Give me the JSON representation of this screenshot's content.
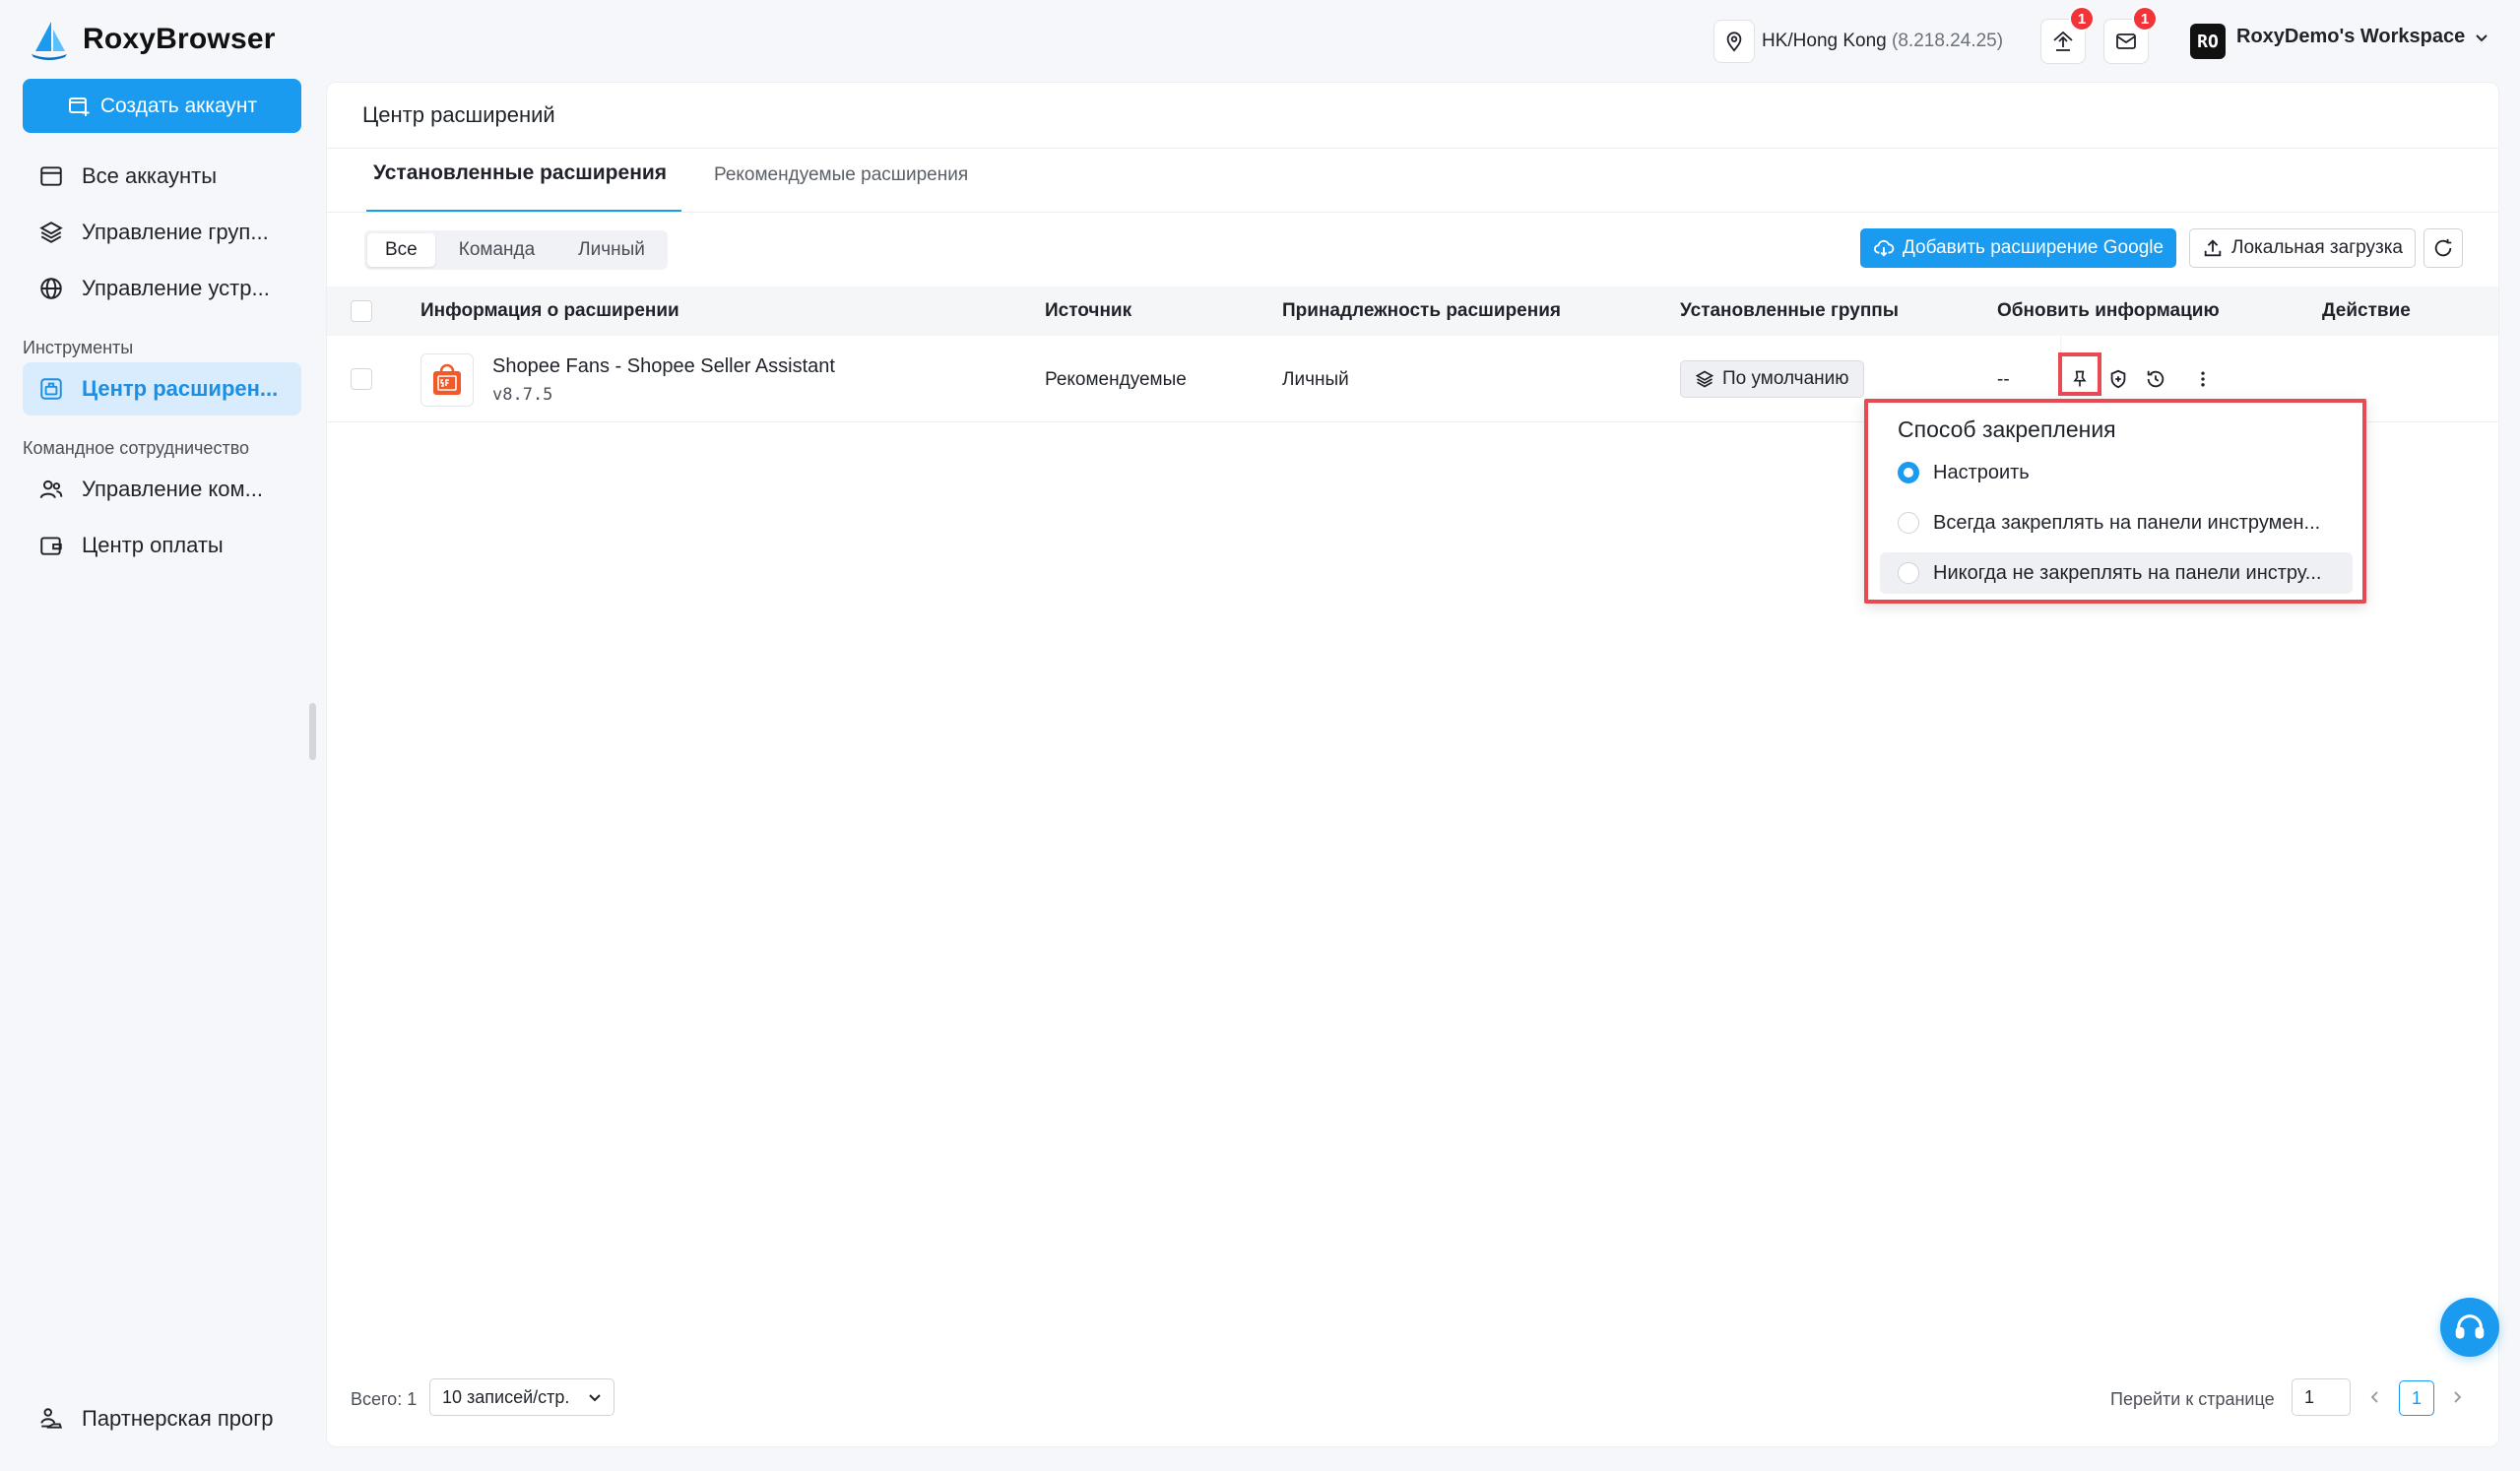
{
  "app": {
    "name": "RoxyBrowser"
  },
  "sidebar": {
    "create_button": "Создать аккаунт",
    "items": [
      {
        "label": "Все аккаунты"
      },
      {
        "label": "Управление груп..."
      },
      {
        "label": "Управление устр..."
      }
    ],
    "section_tools": "Инструменты",
    "tools_items": [
      {
        "label": "Центр расширен..."
      }
    ],
    "section_team": "Командное сотрудничество",
    "team_items": [
      {
        "label": "Управление ком..."
      },
      {
        "label": "Центр оплаты"
      }
    ],
    "bottom_item": "Партнерская прогр"
  },
  "topbar": {
    "location": "HK/Hong Kong",
    "ip": "(8.218.24.25)",
    "upload_badge": "1",
    "mail_badge": "1",
    "workspace_avatar": "RO",
    "workspace_name": "RoxyDemo's Workspace"
  },
  "page": {
    "title": "Центр расширений",
    "tabs": [
      {
        "label": "Установленные расширения",
        "active": true
      },
      {
        "label": "Рекомендуемые расширения",
        "active": false
      }
    ],
    "filters": [
      "Все",
      "Команда",
      "Личный"
    ],
    "add_google_button": "Добавить расширение Google",
    "local_upload_button": "Локальная загрузка"
  },
  "table": {
    "headers": {
      "info": "Информация о расширении",
      "source": "Источник",
      "ownership": "Принадлежность расширения",
      "groups": "Установленные группы",
      "update": "Обновить информацию",
      "action": "Действие"
    },
    "rows": [
      {
        "name": "Shopee Fans - Shopee Seller Assistant",
        "version": "v8.7.5",
        "source": "Рекомендуемые",
        "ownership": "Личный",
        "group": "По умолчанию",
        "update": "--"
      }
    ]
  },
  "popover": {
    "title": "Способ закрепления",
    "options": [
      {
        "label": "Настроить",
        "checked": true
      },
      {
        "label": "Всегда закреплять на панели инструмен...",
        "checked": false
      },
      {
        "label": "Никогда не закреплять на панели инстру...",
        "checked": false
      }
    ]
  },
  "pagination": {
    "total": "Всего: 1",
    "page_size": "10 записей/стр.",
    "goto_label": "Перейти к странице",
    "goto_value": "1",
    "current_page": "1"
  },
  "colors": {
    "accent": "#1a9bf0",
    "highlight_border": "#e84a54",
    "badge": "#f2343a"
  }
}
